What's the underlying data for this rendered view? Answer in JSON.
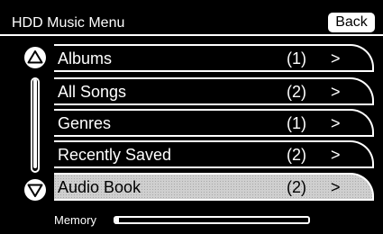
{
  "header": {
    "title": "HDD Music Menu",
    "back_label": "Back"
  },
  "menu": {
    "items": [
      {
        "label": "Albums",
        "count": "(1)",
        "arrow": ">",
        "selected": false
      },
      {
        "label": "All Songs",
        "count": "(2)",
        "arrow": ">",
        "selected": false
      },
      {
        "label": "Genres",
        "count": "(1)",
        "arrow": ">",
        "selected": false
      },
      {
        "label": "Recently Saved",
        "count": "(2)",
        "arrow": ">",
        "selected": false
      },
      {
        "label": "Audio Book",
        "count": "(2)",
        "arrow": ">",
        "selected": true
      }
    ]
  },
  "scroll": {
    "up_icon": "triangle-up-icon",
    "down_icon": "triangle-down-icon",
    "position_fraction": 0.0,
    "visible_fraction": 0.97
  },
  "memory": {
    "label": "Memory",
    "used_fraction": 0.02
  },
  "colors": {
    "background": "#000000",
    "foreground": "#ffffff",
    "selected_background": "#cfcfcf"
  }
}
